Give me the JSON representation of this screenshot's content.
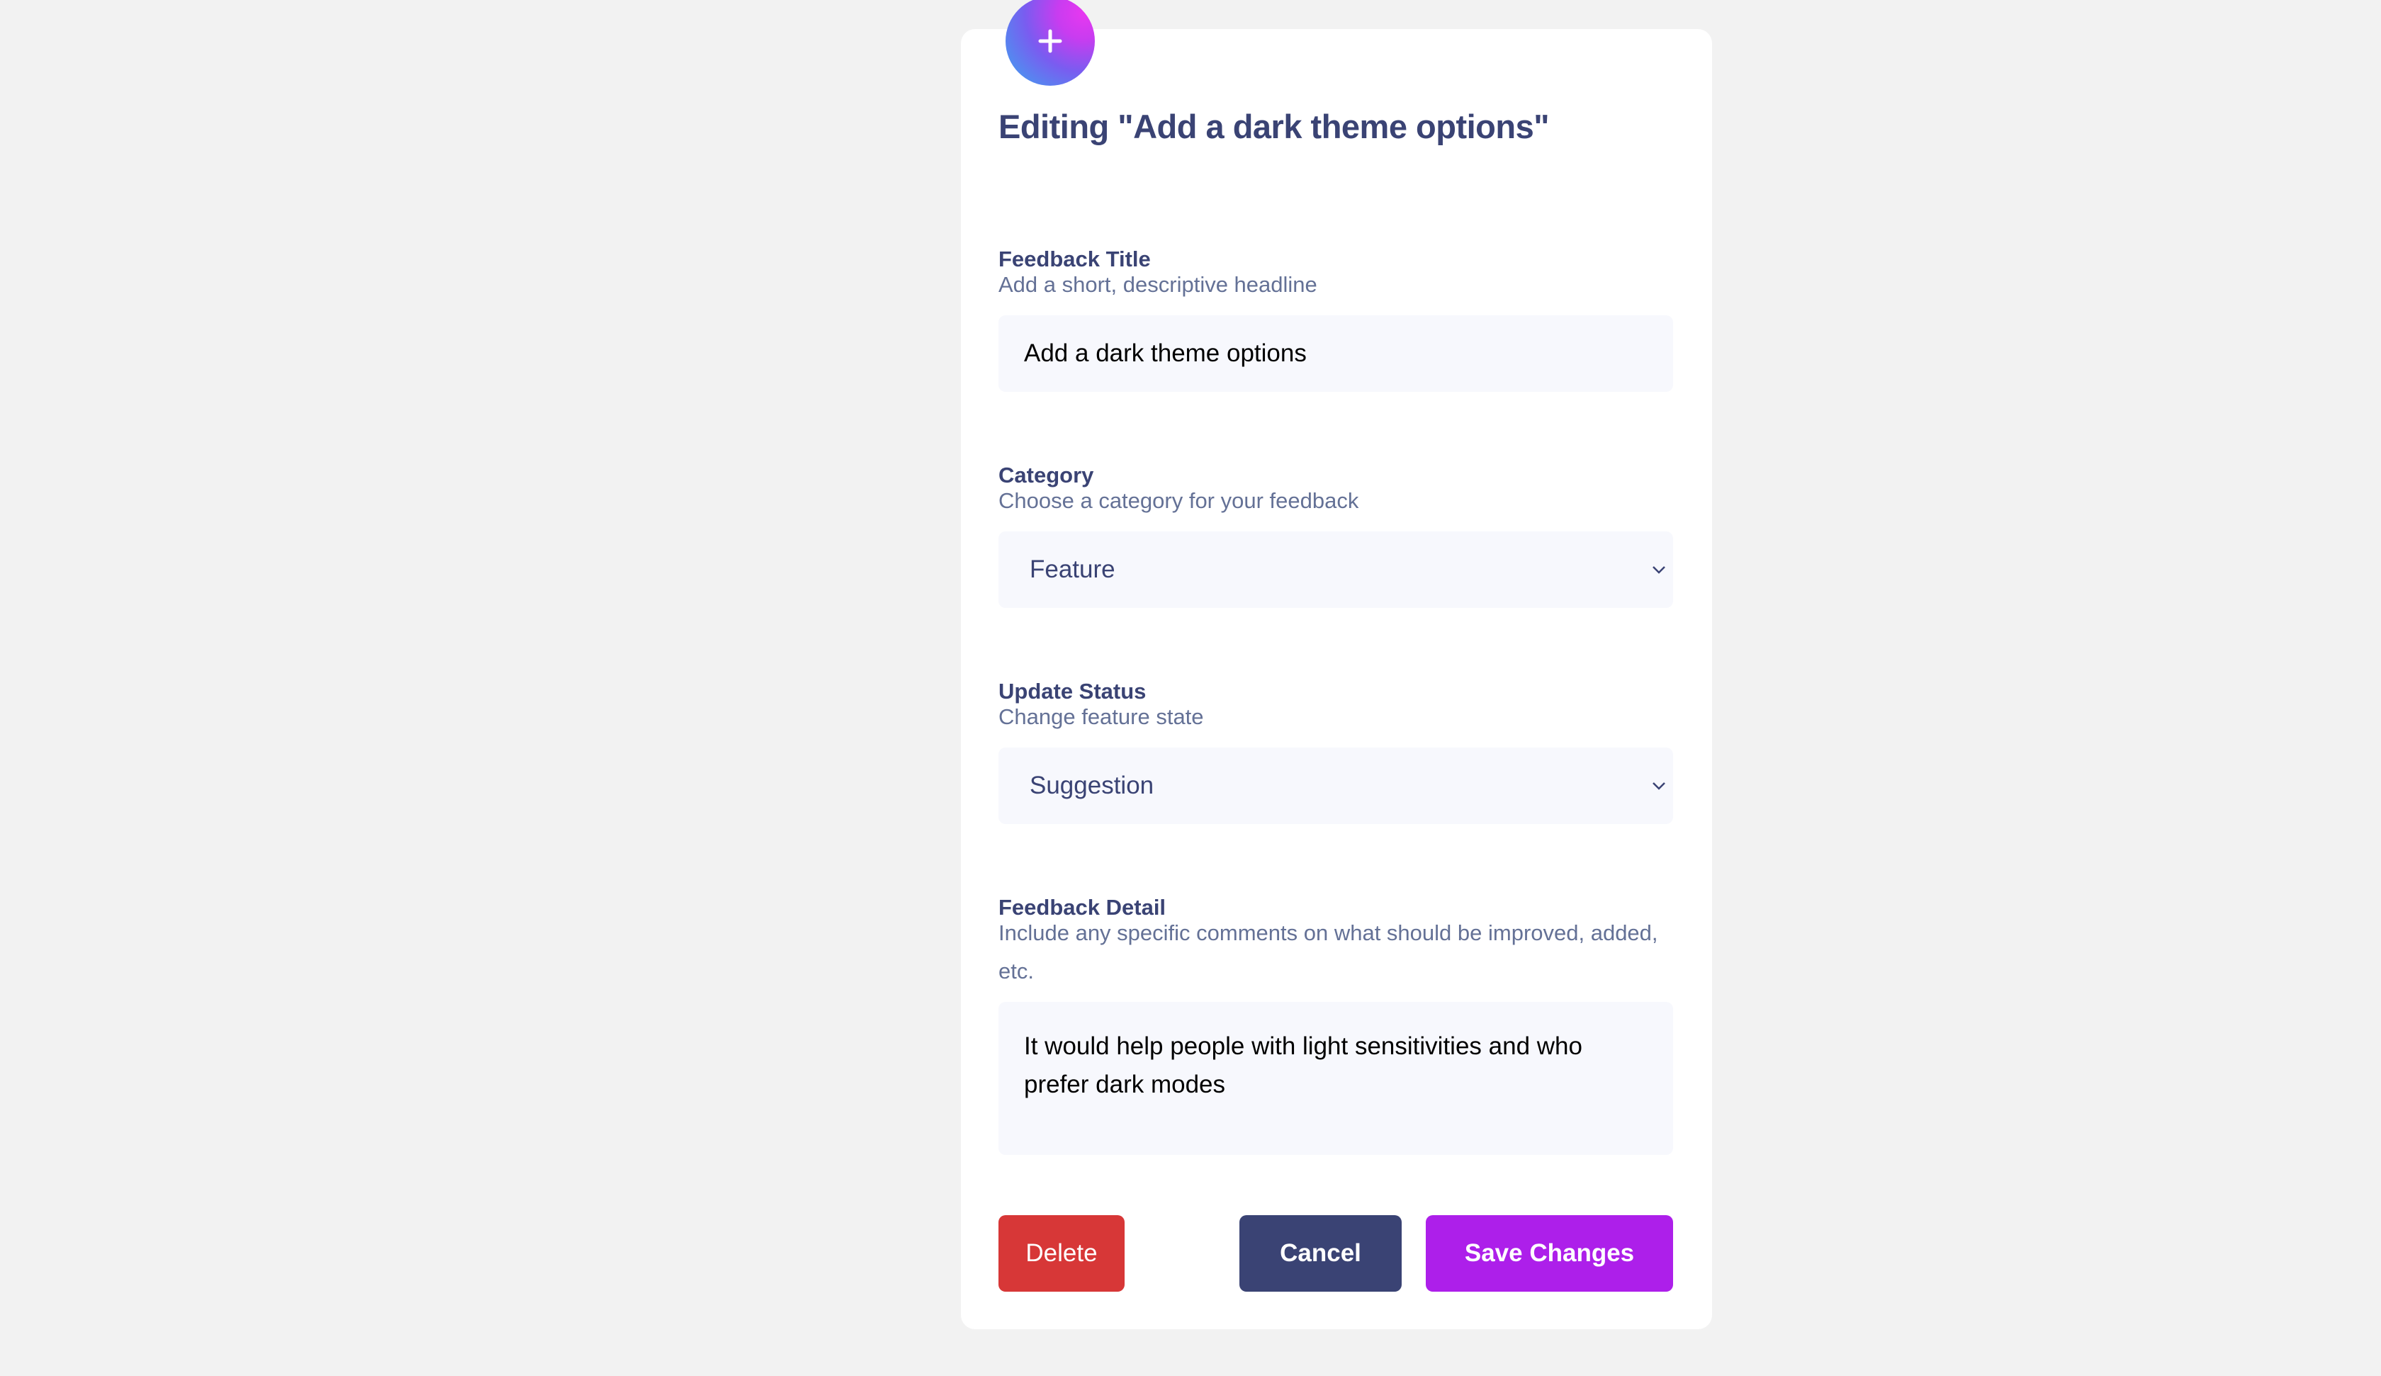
{
  "page": {
    "heading": "Editing \"Add a dark theme options\""
  },
  "badge": {
    "icon": "plus-icon"
  },
  "title_field": {
    "label": "Feedback Title",
    "hint": "Add a short, descriptive headline",
    "value": "Add a dark theme options"
  },
  "category_field": {
    "label": "Category",
    "hint": "Choose a category for your feedback",
    "selected": "Feature",
    "icon": "chevron-down-icon"
  },
  "status_field": {
    "label": "Update Status",
    "hint": "Change feature state",
    "selected": "Suggestion",
    "icon": "chevron-down-icon"
  },
  "detail_field": {
    "label": "Feedback Detail",
    "hint": "Include any specific comments on what should be improved, added, etc.",
    "value": "It would help people with light sensitivities and who prefer dark modes"
  },
  "actions": {
    "delete_label": "Delete",
    "cancel_label": "Cancel",
    "save_label": "Save Changes"
  },
  "colors": {
    "background": "#f2f2f2",
    "card": "#ffffff",
    "heading": "#3a4374",
    "hint": "#647196",
    "field_bg": "#f7f8fd",
    "delete": "#d73737",
    "cancel": "#3a4374",
    "save": "#ad1fea"
  }
}
